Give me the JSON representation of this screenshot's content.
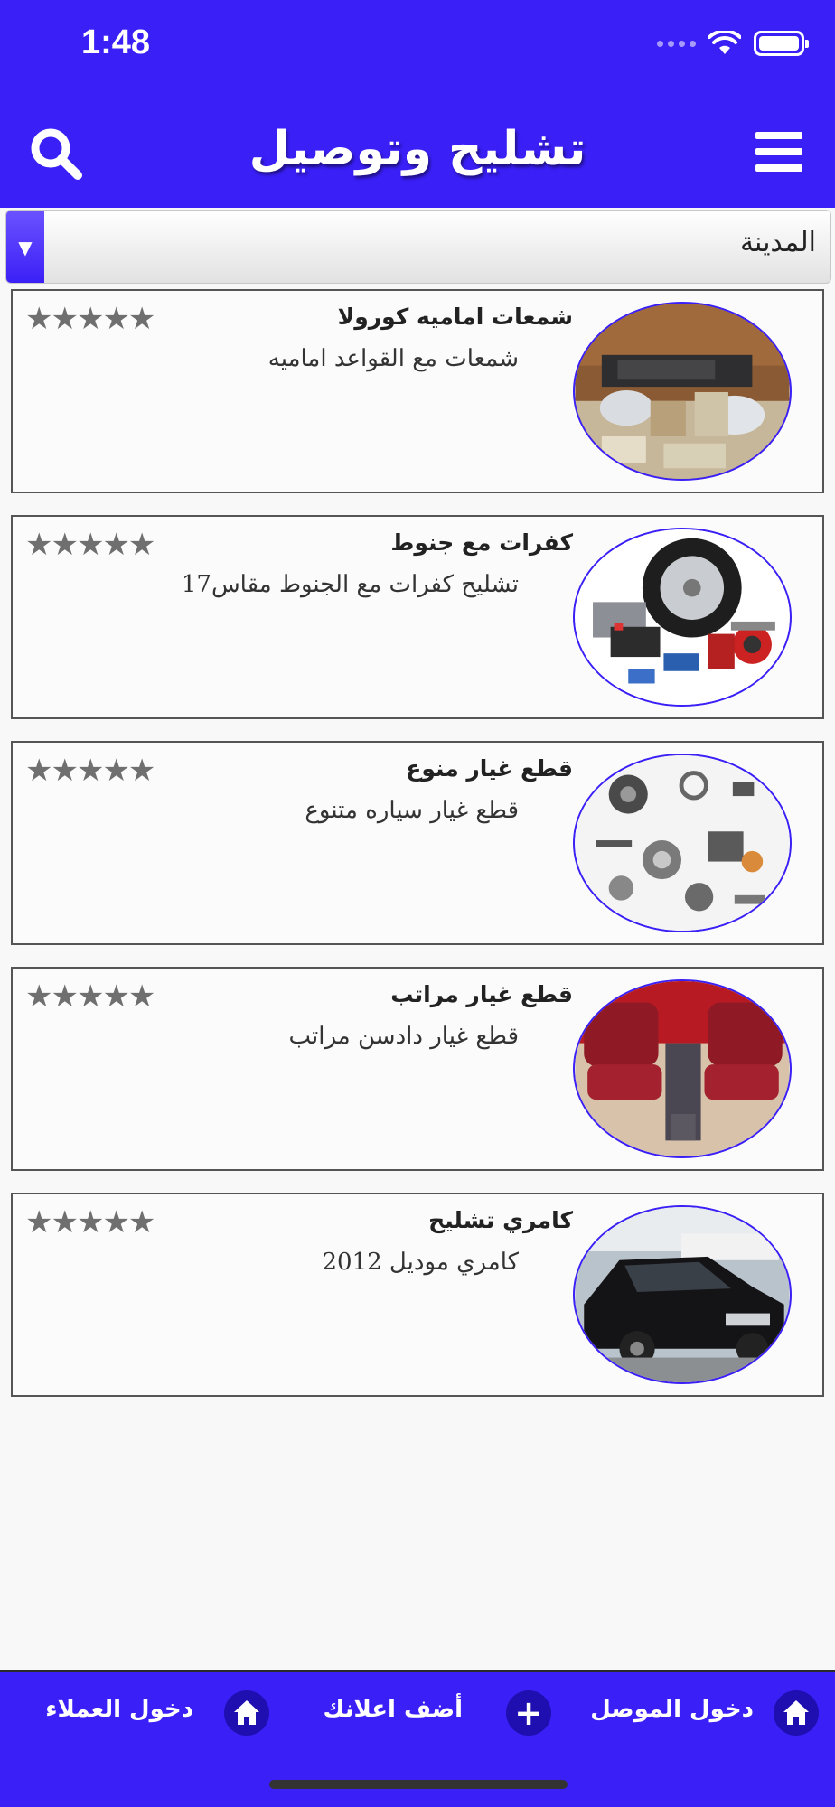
{
  "status_bar": {
    "time": "1:48"
  },
  "header": {
    "title": "تشليح وتوصيل"
  },
  "city_dropdown": {
    "value": "المدينة"
  },
  "listings": [
    {
      "title": "شمعات اماميه كورولا",
      "description": "شمعات مع القواعد اماميه",
      "rating": 5,
      "image": "headlights-image"
    },
    {
      "title": "كفرات مع جنوط",
      "description": "تشليح كفرات مع الجنوط مقاس17",
      "rating": 5,
      "image": "tires-wheels-image"
    },
    {
      "title": "قطع غيار منوع",
      "description": "قطع غيار سياره متنوع",
      "rating": 5,
      "image": "assorted-parts-image"
    },
    {
      "title": "قطع غيار مراتب",
      "description": "قطع غيار دادسن مراتب",
      "rating": 5,
      "image": "red-seats-image"
    },
    {
      "title": "كامري تشليح",
      "description": "كامري موديل 2012",
      "rating": 5,
      "image": "black-car-image"
    }
  ],
  "bottom_nav": {
    "items": [
      {
        "label": "دخول الموصل",
        "icon": "home-icon"
      },
      {
        "label": "أضف اعلانك",
        "icon": "plus-icon"
      },
      {
        "label": "دخول العملاء",
        "icon": "home-icon"
      }
    ]
  },
  "colors": {
    "primary": "#3a1ff6",
    "star": "#6f6f6f"
  }
}
